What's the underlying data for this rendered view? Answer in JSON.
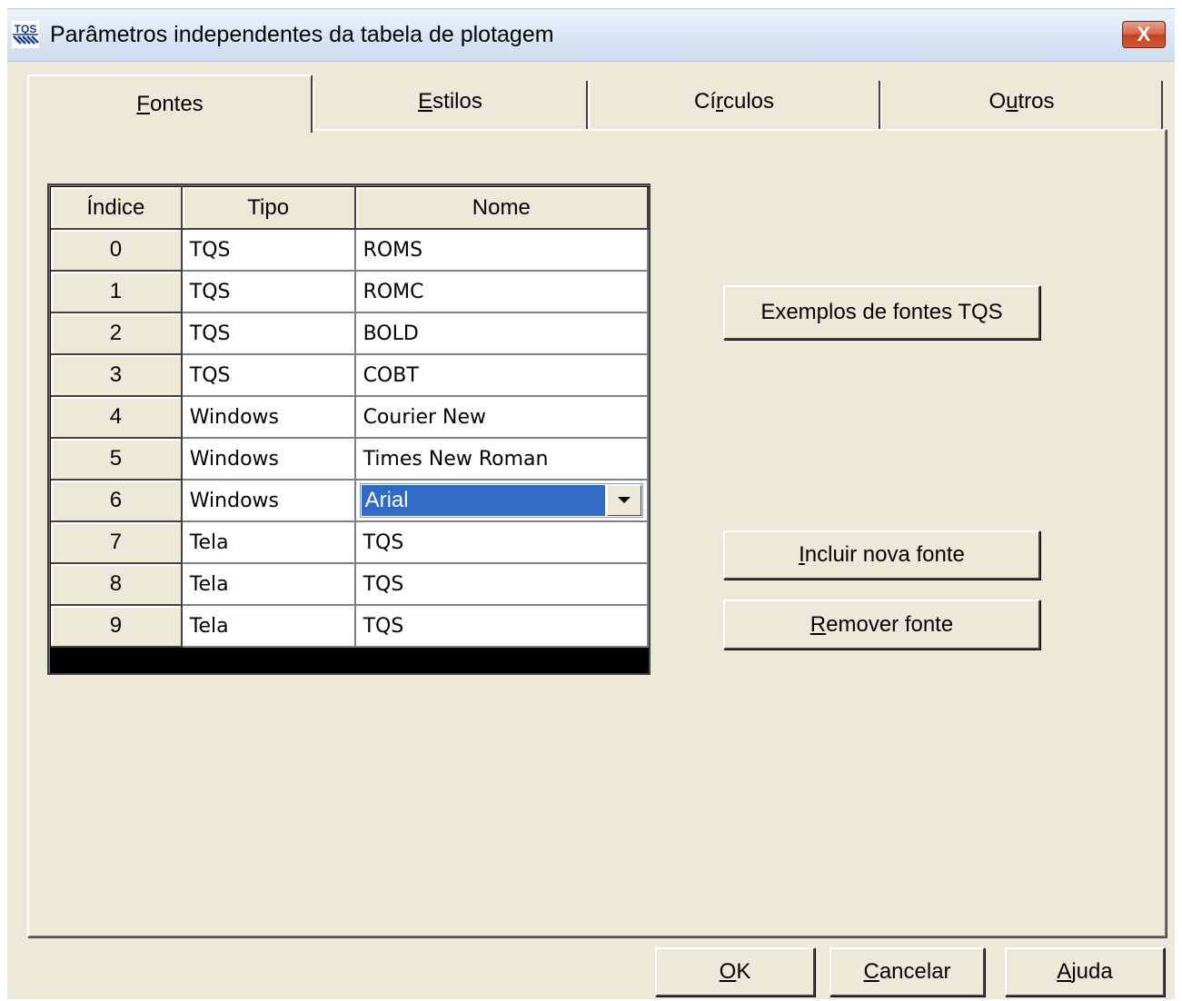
{
  "window": {
    "title": "Parâmetros independentes da tabela de plotagem",
    "icon": "TQS",
    "close_label": "X"
  },
  "tabs": [
    {
      "first": "F",
      "rest": "ontes",
      "active": true
    },
    {
      "first": "E",
      "rest": "stilos",
      "active": false
    },
    {
      "pre": "Cí",
      "first": "r",
      "rest": "culos",
      "active": false
    },
    {
      "pre": "O",
      "first": "u",
      "rest": "tros",
      "active": false
    }
  ],
  "fonts_table": {
    "headers": [
      "Índice",
      "Tipo",
      "Nome"
    ],
    "rows": [
      {
        "index": "0",
        "tipo": "TQS",
        "nome": "ROMS"
      },
      {
        "index": "1",
        "tipo": "TQS",
        "nome": "ROMC"
      },
      {
        "index": "2",
        "tipo": "TQS",
        "nome": "BOLD"
      },
      {
        "index": "3",
        "tipo": "TQS",
        "nome": "COBT"
      },
      {
        "index": "4",
        "tipo": "Windows",
        "nome": "Courier New"
      },
      {
        "index": "5",
        "tipo": "Windows",
        "nome": "Times New Roman"
      },
      {
        "index": "6",
        "tipo": "Windows",
        "nome": "Arial"
      },
      {
        "index": "7",
        "tipo": "Tela",
        "nome": "TQS"
      },
      {
        "index": "8",
        "tipo": "Tela",
        "nome": "TQS"
      },
      {
        "index": "9",
        "tipo": "Tela",
        "nome": "TQS"
      }
    ],
    "editing_row": 6
  },
  "buttons": {
    "exemplos": {
      "label": "Exemplos de fontes TQS"
    },
    "incluir": {
      "first": "I",
      "rest": "ncluir nova fonte"
    },
    "remover": {
      "first": "R",
      "rest": "emover fonte"
    },
    "ok": {
      "first": "O",
      "rest": "K"
    },
    "cancelar": {
      "first": "C",
      "rest": "ancelar"
    },
    "ajuda": {
      "first": "A",
      "rest": "juda"
    }
  },
  "colors": {
    "face": "#ece9d8",
    "selection": "#316ac5",
    "close": "#c2401f"
  }
}
